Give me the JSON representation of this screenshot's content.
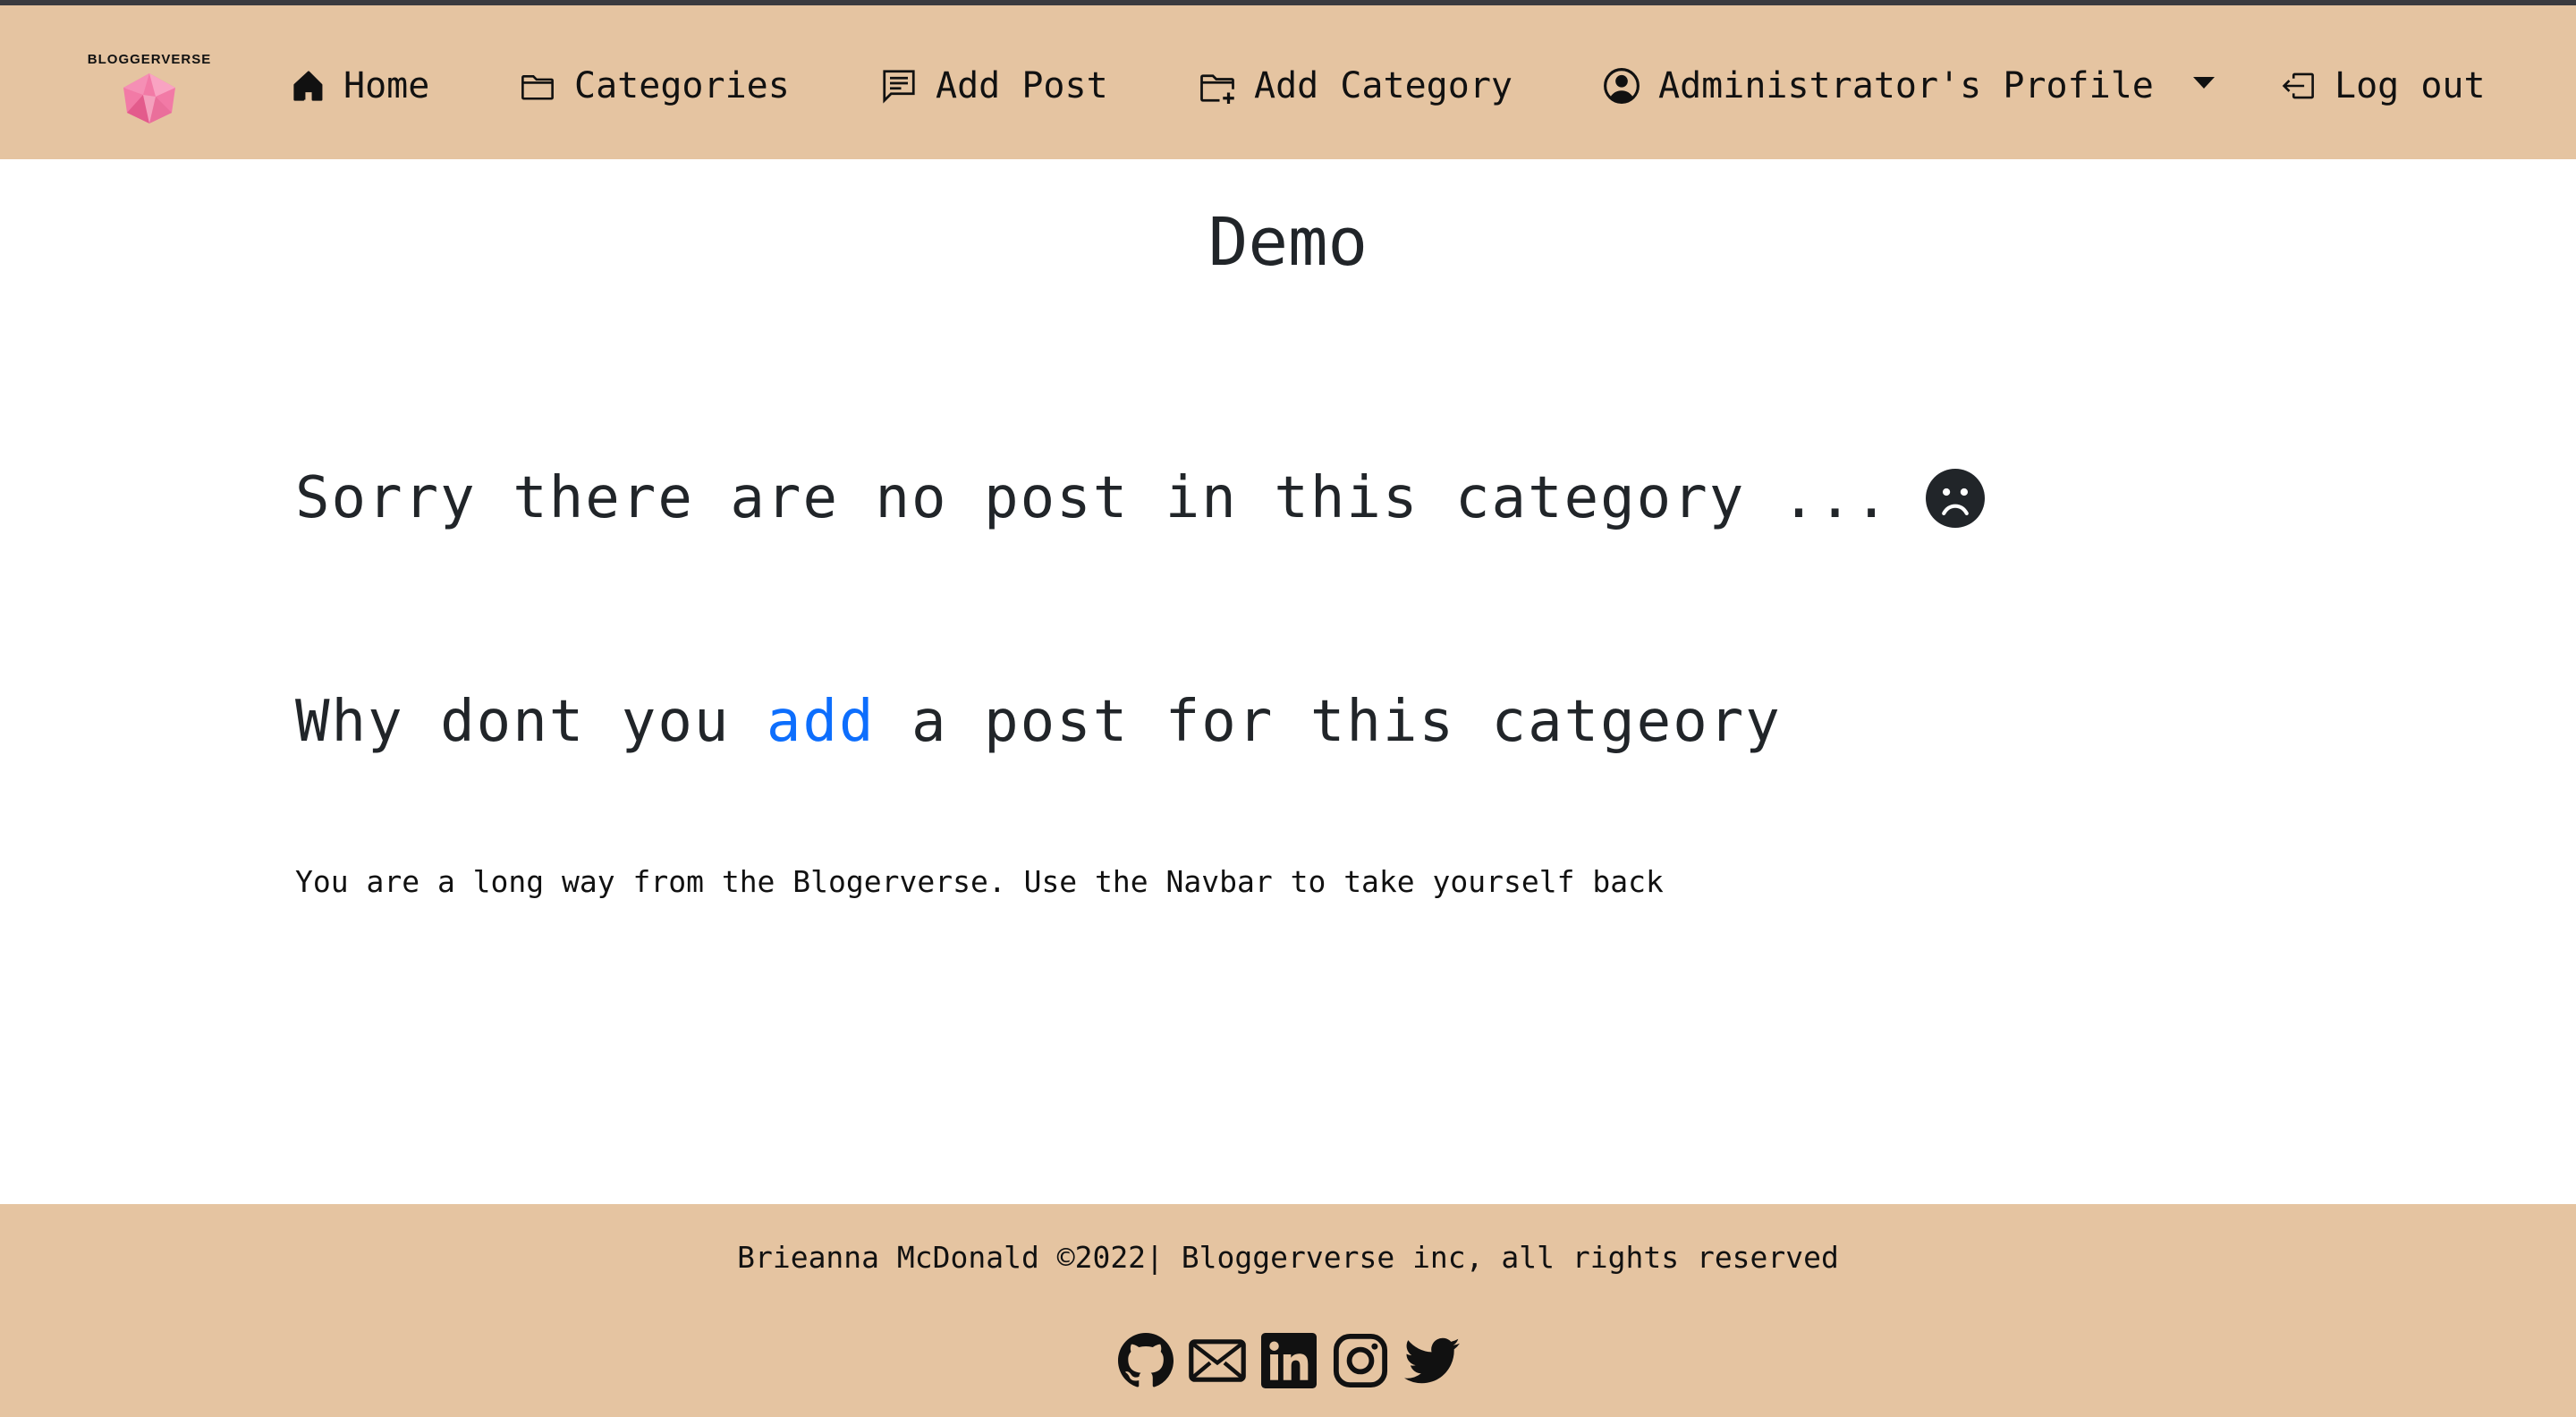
{
  "nav": {
    "brand": "BLOGGERVERSE",
    "items": [
      {
        "label": "Home",
        "icon": "house-icon"
      },
      {
        "label": "Categories",
        "icon": "folder-icon"
      },
      {
        "label": "Add Post",
        "icon": "chat-text-icon"
      },
      {
        "label": "Add Category",
        "icon": "folder-plus-icon"
      },
      {
        "label": "Administrator's Profile",
        "icon": "person-circle-icon"
      },
      {
        "label": "Log out",
        "icon": "box-arrow-left-icon"
      }
    ]
  },
  "main": {
    "title": "Demo",
    "empty_message": "Sorry there are no post in this category ...",
    "prompt_before": "Why dont you ",
    "prompt_link": "add",
    "prompt_after": " a post for this catgeory",
    "far_message": "You are a long way from the Blogerverse. Use the Navbar to take yourself back"
  },
  "footer": {
    "copyright": "Brieanna McDonald ©2022| Bloggerverse inc, all rights reserved",
    "socials": [
      "github-icon",
      "envelope-icon",
      "linkedin-icon",
      "instagram-icon",
      "twitter-icon"
    ]
  },
  "colors": {
    "navbar_bg": "#e5c4a1",
    "link": "#0d6efd",
    "text": "#212529",
    "brand_gem": "#f06a9b"
  }
}
